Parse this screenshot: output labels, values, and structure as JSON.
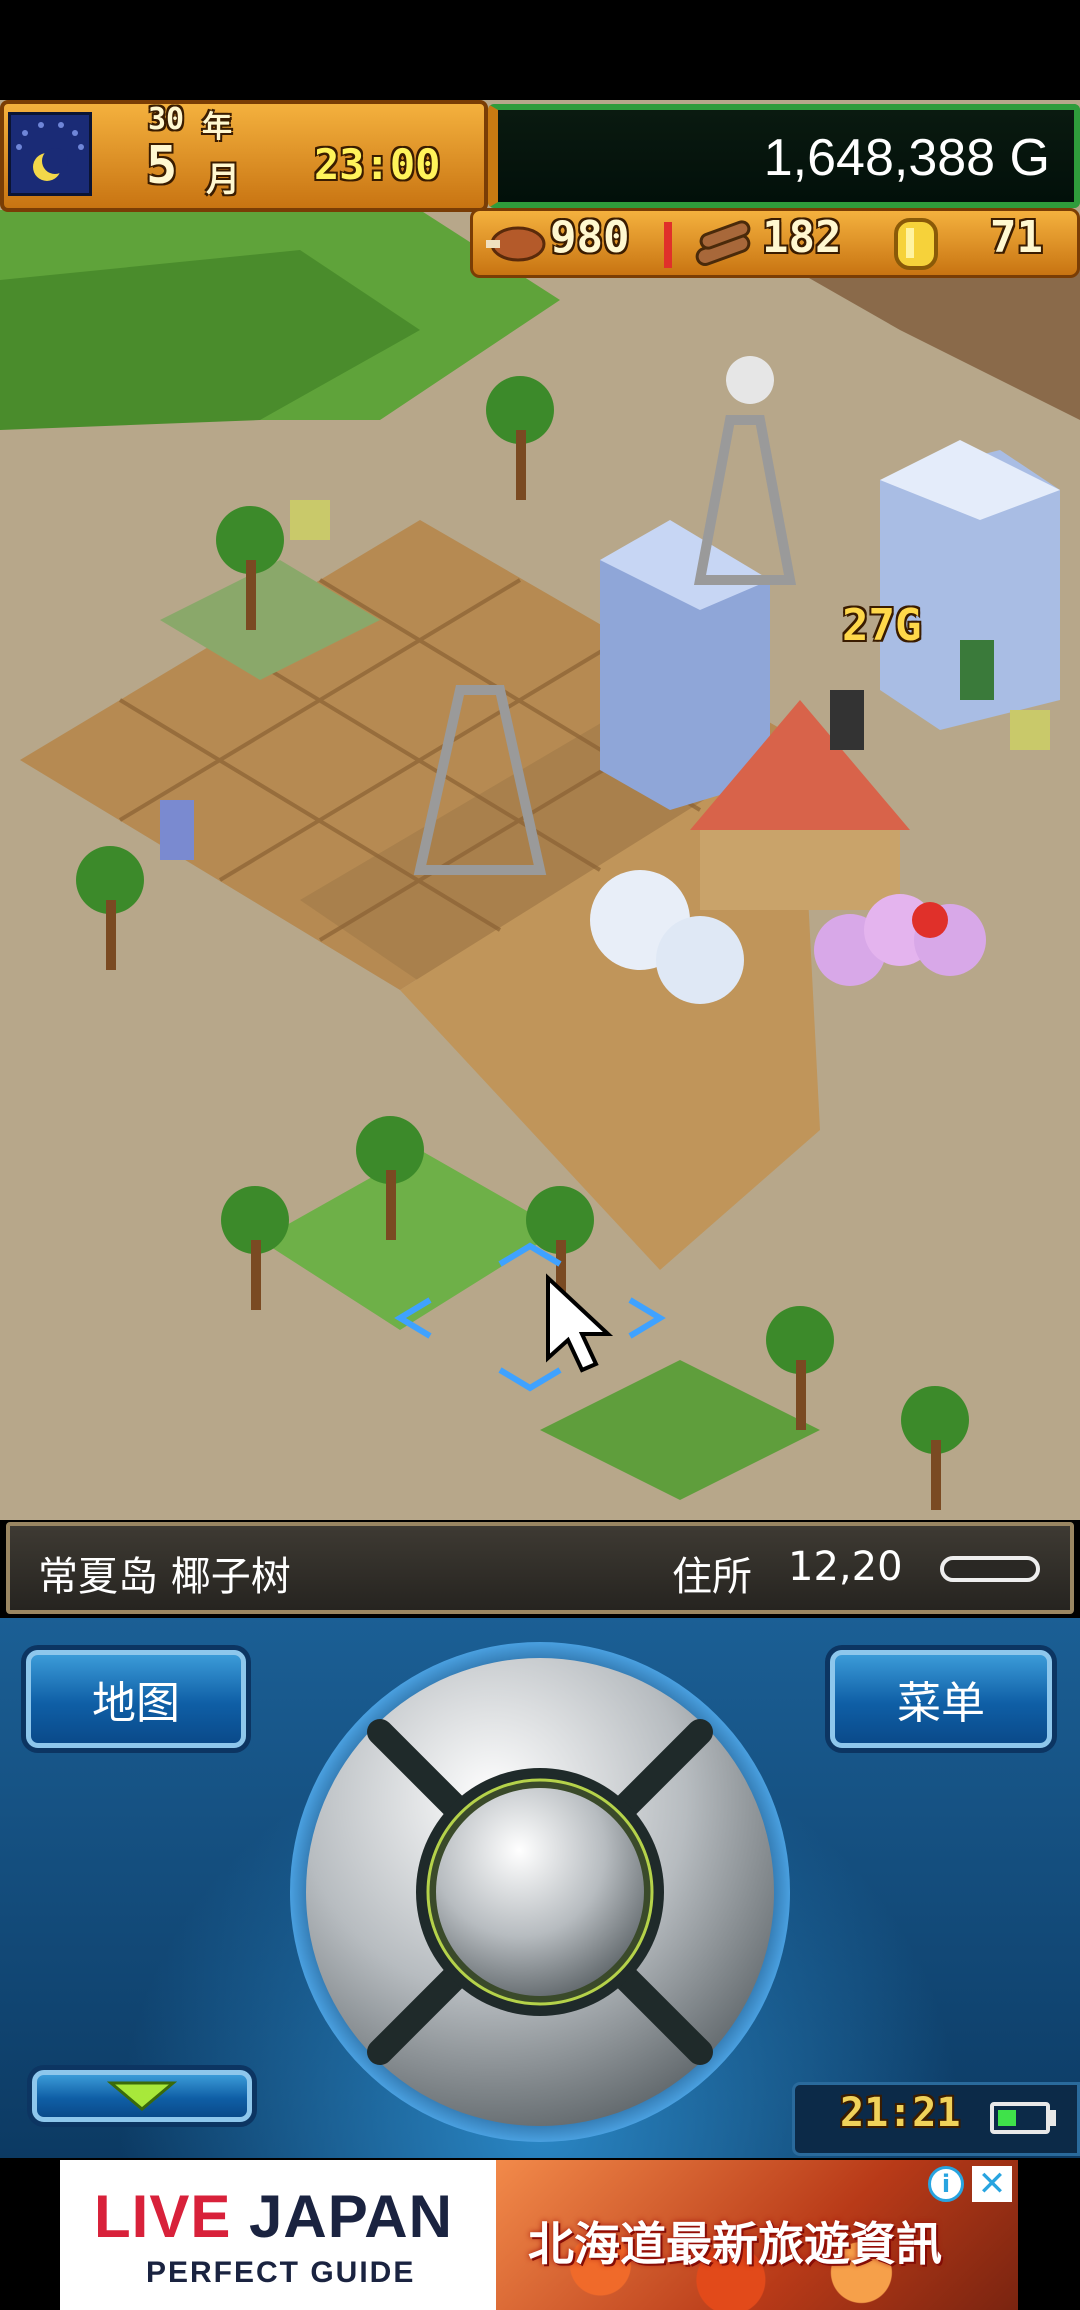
{
  "hud": {
    "year": "30",
    "year_unit": "年",
    "month": "5",
    "month_unit": "月",
    "time": "23:00",
    "money": "1,648,388 G",
    "resources": [
      {
        "icon": "food-icon",
        "value": "980"
      },
      {
        "icon": "wood-icon",
        "value": "182"
      },
      {
        "icon": "medal-icon",
        "value": "71"
      }
    ]
  },
  "world": {
    "floating_income": "27G"
  },
  "info_bar": {
    "location_name": "常夏岛 椰子树",
    "address_label": "住所",
    "address_value": "12,20"
  },
  "controls": {
    "map_label": "地图",
    "menu_label": "菜单",
    "clock": "21:21"
  },
  "ad": {
    "brand_live": "LIVE",
    "brand_japan": " JAPAN",
    "tagline": "PERFECT GUIDE",
    "headline": "北海道最新旅遊資訊",
    "info_glyph": "i",
    "close_glyph": "✕"
  },
  "colors": {
    "hud_orange": "#e89a28",
    "money_border": "#2f9c3b",
    "panel_blue": "#1b5f95",
    "selection_blue": "#3fa2ff",
    "ad_red": "#d8213a"
  }
}
